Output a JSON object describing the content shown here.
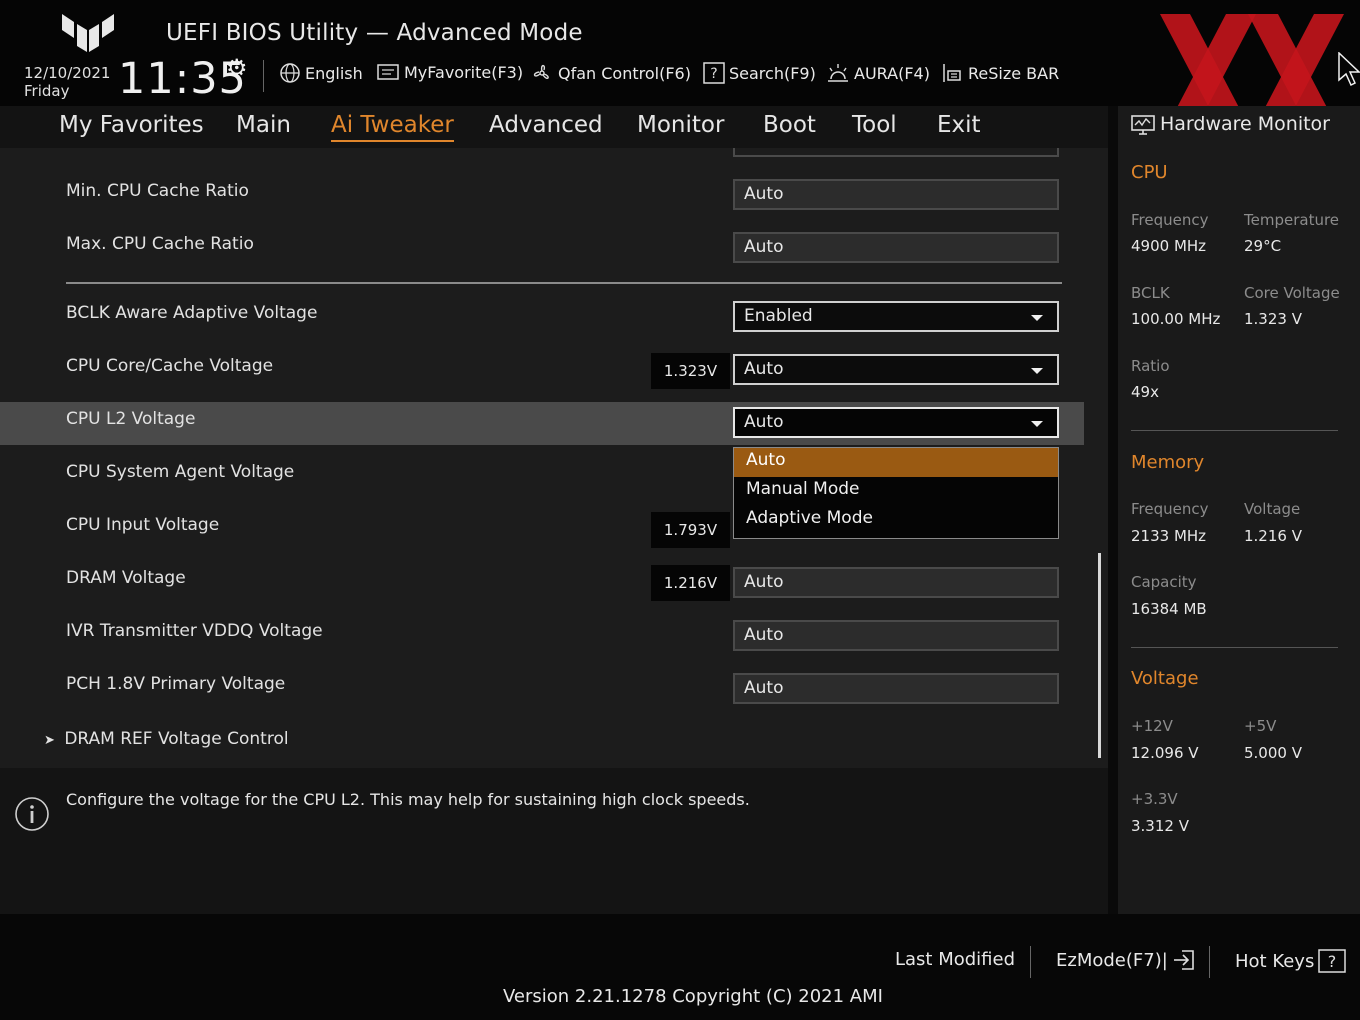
{
  "header": {
    "app_title": "UEFI BIOS Utility — Advanced Mode",
    "date": "12/10/2021",
    "weekday": "Friday",
    "time": "11:35",
    "items": [
      {
        "label": "English",
        "icon": "globe-icon"
      },
      {
        "label": "MyFavorite(F3)",
        "icon": "favorite-icon"
      },
      {
        "label": "Qfan Control(F6)",
        "icon": "fan-icon"
      },
      {
        "label": "Search(F9)",
        "icon": "search-icon"
      },
      {
        "label": "AURA(F4)",
        "icon": "aura-icon"
      },
      {
        "label": "ReSize BAR",
        "icon": "resize-bar-icon"
      }
    ]
  },
  "nav": {
    "tabs": [
      "My Favorites",
      "Main",
      "Ai Tweaker",
      "Advanced",
      "Monitor",
      "Boot",
      "Tool",
      "Exit"
    ],
    "active": "Ai Tweaker"
  },
  "settings": [
    {
      "label": "Min. CPU Cache Ratio",
      "value": "Auto"
    },
    {
      "label": "Max. CPU Cache Ratio",
      "value": "Auto"
    },
    {
      "label": "BCLK Aware Adaptive Voltage",
      "value": "Enabled"
    },
    {
      "label": "CPU Core/Cache Voltage",
      "value": "Auto",
      "reading": "1.323V"
    },
    {
      "label": "CPU L2 Voltage",
      "value": "Auto"
    },
    {
      "label": "CPU System Agent Voltage"
    },
    {
      "label": "CPU Input Voltage",
      "reading": "1.793V"
    },
    {
      "label": "DRAM Voltage",
      "value": "Auto",
      "reading": "1.216V"
    },
    {
      "label": "IVR Transmitter VDDQ Voltage",
      "value": "Auto"
    },
    {
      "label": "PCH 1.8V Primary Voltage",
      "value": "Auto"
    },
    {
      "label": "DRAM REF Voltage Control"
    }
  ],
  "dropdown": {
    "options": [
      "Auto",
      "Manual Mode",
      "Adaptive Mode"
    ],
    "selected": "Auto"
  },
  "help": {
    "text": "Configure the voltage for the CPU L2. This may help for sustaining high clock speeds."
  },
  "hw_monitor": {
    "title": "Hardware Monitor",
    "cpu": {
      "heading": "CPU",
      "frequency_label": "Frequency",
      "frequency": "4900 MHz",
      "temperature_label": "Temperature",
      "temperature": "29°C",
      "bclk_label": "BCLK",
      "bclk": "100.00 MHz",
      "core_voltage_label": "Core Voltage",
      "core_voltage": "1.323 V",
      "ratio_label": "Ratio",
      "ratio": "49x"
    },
    "memory": {
      "heading": "Memory",
      "frequency_label": "Frequency",
      "frequency": "2133 MHz",
      "voltage_label": "Voltage",
      "voltage": "1.216 V",
      "capacity_label": "Capacity",
      "capacity": "16384 MB"
    },
    "voltage": {
      "heading": "Voltage",
      "v12_label": "+12V",
      "v12": "12.096 V",
      "v5_label": "+5V",
      "v5": "5.000 V",
      "v33_label": "+3.3V",
      "v33": "3.312 V"
    }
  },
  "footer": {
    "last_modified": "Last Modified",
    "ezmode": "EzMode(F7)|",
    "hotkeys": "Hot Keys",
    "version": "Version 2.21.1278 Copyright (C) 2021 AMI"
  },
  "colors": {
    "accent": "#e0862c",
    "selected_option": "#9a5a12",
    "watermark": "#c4151c"
  }
}
